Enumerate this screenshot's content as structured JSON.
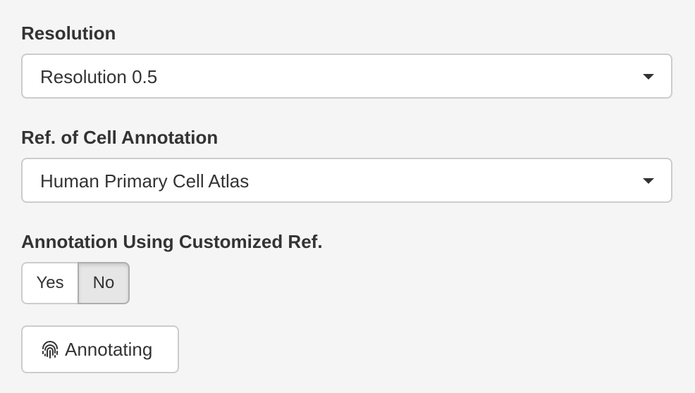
{
  "resolution": {
    "label": "Resolution",
    "selected": "Resolution 0.5"
  },
  "reference": {
    "label": "Ref. of Cell Annotation",
    "selected": "Human Primary Cell Atlas"
  },
  "customized_ref": {
    "label": "Annotation Using Customized Ref.",
    "options": [
      "Yes",
      "No"
    ],
    "selected": "No"
  },
  "annotate_button": {
    "label": "Annotating",
    "icon": "fingerprint-icon"
  }
}
